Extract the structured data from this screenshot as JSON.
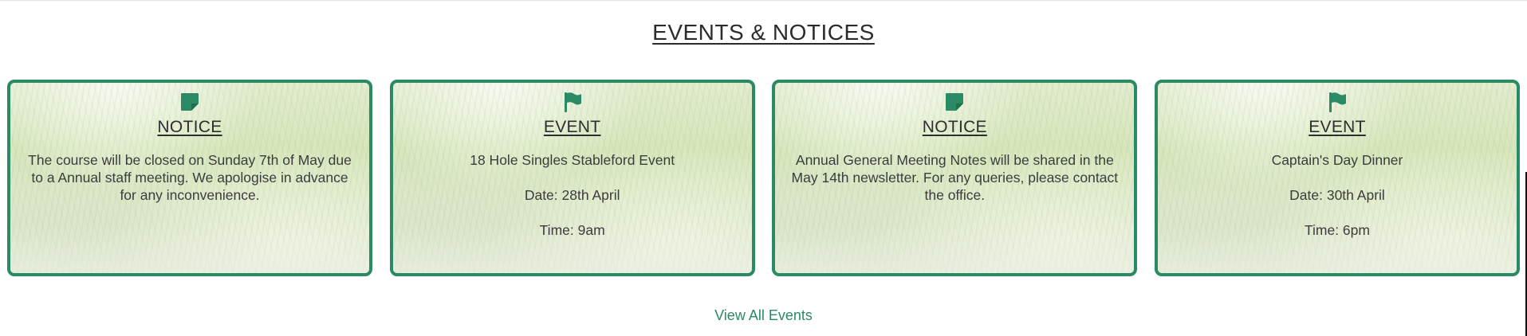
{
  "section": {
    "title": "EVENTS & NOTICES"
  },
  "colors": {
    "accent": "#2a8a64",
    "text": "#3c3c3c"
  },
  "cards": [
    {
      "icon": "sticky-note-icon",
      "type": "NOTICE",
      "text": "The course will be closed on Sunday 7th of May due to a Annual staff meeting. We apologise in advance for any inconvenience."
    },
    {
      "icon": "flag-icon",
      "type": "EVENT",
      "title": "18 Hole Singles Stableford Event",
      "date": "Date: 28th April",
      "time": "Time: 9am"
    },
    {
      "icon": "sticky-note-icon",
      "type": "NOTICE",
      "text": "Annual General Meeting Notes will be shared in the May 14th newsletter. For any queries, please contact the office."
    },
    {
      "icon": "flag-icon",
      "type": "EVENT",
      "title": "Captain's Day Dinner",
      "date": "Date: 30th April",
      "time": "Time: 6pm"
    }
  ],
  "footer": {
    "view_all_label": "View All Events"
  }
}
